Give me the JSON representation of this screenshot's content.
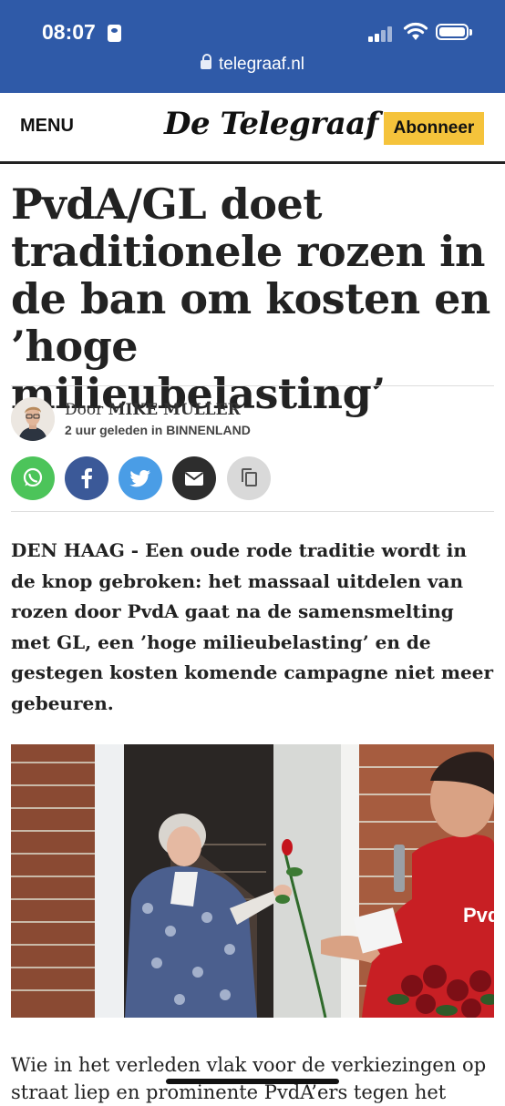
{
  "status_bar": {
    "time": "08:07"
  },
  "browser": {
    "url": "telegraaf.nl"
  },
  "header": {
    "menu_label": "MENU",
    "logo_text": "De Telegraaf",
    "subscribe_label": "Abonneer"
  },
  "article": {
    "headline": "PvdA/GL doet traditionele rozen in de ban om kosten en ’hoge milieubelasting’",
    "byline": {
      "prefix": "Door",
      "author": "MIKE MULLER",
      "time": "2 uur geleden",
      "in_label": "in",
      "section": "BINNENLAND"
    },
    "share": [
      "whatsapp-icon",
      "facebook-icon",
      "twitter-icon",
      "mail-icon",
      "copy-icon"
    ],
    "lead": "DEN HAAG - Een oude rode traditie wordt in de knop gebroken: het massaal uitdelen van rozen door PvdA gaat na de samensmelting met GL, een ’hoge milieubelasting’ en de gestegen kosten komende campagne niet meer gebeuren.",
    "photo_text": "PvdA",
    "body_start": "Wie in het verleden vlak voor de verkiezingen op straat liep en prominente PvdA’ers tegen het"
  },
  "colors": {
    "status_bar": "#2f5aa8",
    "subscribe": "#f5c33b",
    "whatsapp": "#4cc45a",
    "facebook": "#3b5998",
    "twitter": "#4a9de6",
    "mail": "#2d2d2d",
    "copy": "#d9d9d9"
  }
}
